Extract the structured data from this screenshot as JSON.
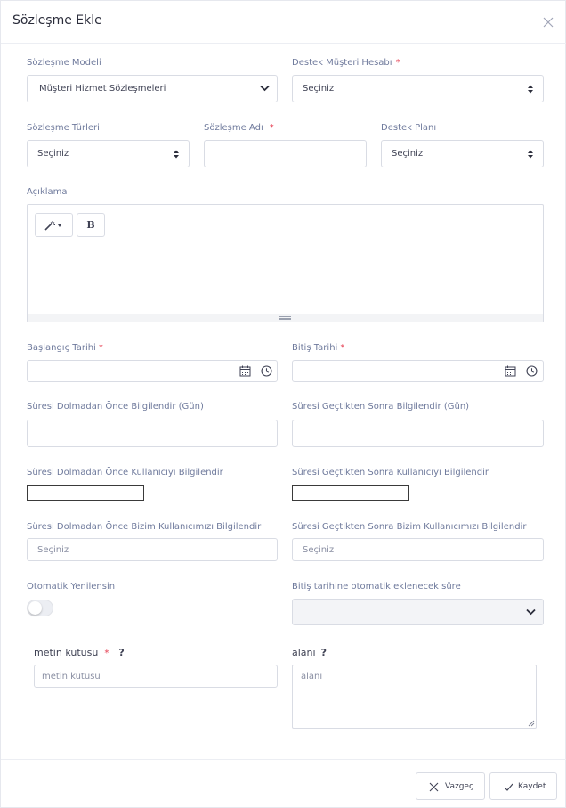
{
  "modal": {
    "title": "Sözleşme Ekle"
  },
  "form": {
    "contract_model": {
      "label": "Sözleşme Modeli",
      "value": "Müşteri Hizmet Sözleşmeleri"
    },
    "support_account": {
      "label": "Destek Müşteri Hesabı",
      "required": "*",
      "value": "Seçiniz"
    },
    "contract_types": {
      "label": "Sözleşme Türleri",
      "value": "Seçiniz"
    },
    "contract_name": {
      "label": "Sözleşme Adı",
      "required": "*",
      "value": ""
    },
    "support_plan": {
      "label": "Destek Planı",
      "value": "Seçiniz"
    },
    "description": {
      "label": "Açıklama",
      "bold_label": "B"
    },
    "start_date": {
      "label": "Başlangıç Tarihi",
      "required": "*"
    },
    "end_date": {
      "label": "Bitiş Tarihi",
      "required": "*"
    },
    "notify_before_days": {
      "label": "Süresi Dolmadan Önce Bilgilendir (Gün)"
    },
    "notify_after_days": {
      "label": "Süresi Geçtikten Sonra Bilgilendir (Gün)"
    },
    "notify_user_before": {
      "label": "Süresi Dolmadan Önce Kullanıcıyı Bilgilendir"
    },
    "notify_user_after": {
      "label": "Süresi Geçtikten Sonra Kullanıcıyı Bilgilendir"
    },
    "notify_our_user_before": {
      "label": "Süresi Dolmadan Önce Bizim Kullanıcımızı Bilgilendir",
      "placeholder": "Seçiniz"
    },
    "notify_our_user_after": {
      "label": "Süresi Geçtikten Sonra Bizim Kullanıcımızı Bilgilendir",
      "placeholder": "Seçiniz"
    },
    "auto_renew": {
      "label": "Otomatik Yenilensin",
      "enabled": false
    },
    "auto_extend_period": {
      "label": "Bitiş tarihine otomatik eklenecek süre",
      "value": ""
    },
    "text_box": {
      "label": "metin kutusu",
      "required": "*",
      "help": "?",
      "placeholder": "metin kutusu"
    },
    "area": {
      "label": "alanı",
      "help": "?",
      "placeholder": "alanı"
    }
  },
  "footer": {
    "cancel_label": "Vazgeç",
    "save_label": "Kaydet"
  },
  "icons": [
    "close-icon",
    "select-arrows-icon",
    "chevron-down-icon",
    "magic-wand-icon",
    "calendar-icon",
    "clock-icon",
    "x-icon",
    "check-icon"
  ]
}
